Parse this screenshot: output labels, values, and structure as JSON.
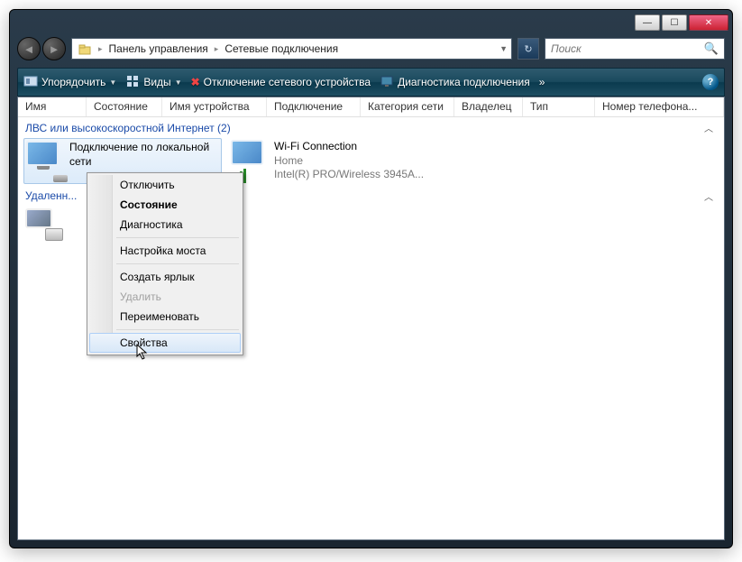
{
  "titlebar": {
    "minimize_glyph": "—",
    "maximize_glyph": "☐",
    "close_glyph": "✕"
  },
  "breadcrumbs": {
    "segment1": "Панель управления",
    "segment2": "Сетевые подключения",
    "arrow": "▸"
  },
  "search": {
    "placeholder": "Поиск"
  },
  "toolbar": {
    "organize": "Упорядочить",
    "views": "Виды",
    "disable_device": "Отключение сетевого устройства",
    "diagnose": "Диагностика подключения",
    "more": "»",
    "help": "?"
  },
  "columns": {
    "name": "Имя",
    "state": "Состояние",
    "device_name": "Имя устройства",
    "connectivity": "Подключение",
    "category": "Категория сети",
    "owner": "Владелец",
    "type": "Тип",
    "phone": "Номер телефона..."
  },
  "groups": {
    "lan_label": "ЛВС или высокоскоростной Интернет (2)",
    "remote_label": "Удаленн..."
  },
  "connections": {
    "lan": {
      "title": "Подключение по локальной сети"
    },
    "wifi": {
      "title": "Wi-Fi Connection",
      "network": "Home",
      "adapter": "Intel(R) PRO/Wireless 3945A..."
    }
  },
  "context_menu": {
    "disable": "Отключить",
    "status": "Состояние",
    "diagnose": "Диагностика",
    "bridge": "Настройка моста",
    "shortcut": "Создать ярлык",
    "delete": "Удалить",
    "rename": "Переименовать",
    "properties": "Свойства"
  }
}
